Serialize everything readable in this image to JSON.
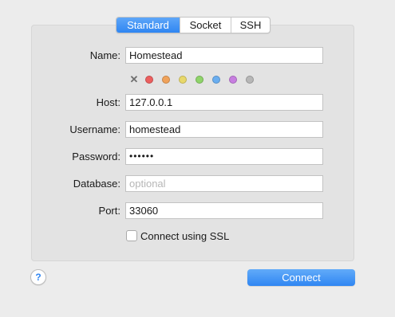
{
  "tabs": [
    "Standard",
    "Socket",
    "SSH"
  ],
  "active_tab": "Standard",
  "form": {
    "name_label": "Name:",
    "name_value": "Homestead",
    "host_label": "Host:",
    "host_value": "127.0.0.1",
    "username_label": "Username:",
    "username_value": "homestead",
    "password_label": "Password:",
    "password_value": "••••••",
    "database_label": "Database:",
    "database_placeholder": "optional",
    "port_label": "Port:",
    "port_value": "33060",
    "ssl_label": "Connect using SSL",
    "ssl_checked": false
  },
  "color_tags": {
    "clear_icon": "x-mark-icon",
    "colors": [
      "#ec5f5f",
      "#f0a25a",
      "#e8d86a",
      "#8fd46a",
      "#6aaef0",
      "#c77ee0",
      "#b7b7b7"
    ]
  },
  "help_glyph": "?",
  "connect_label": "Connect",
  "accent_color": "#2f86f2"
}
